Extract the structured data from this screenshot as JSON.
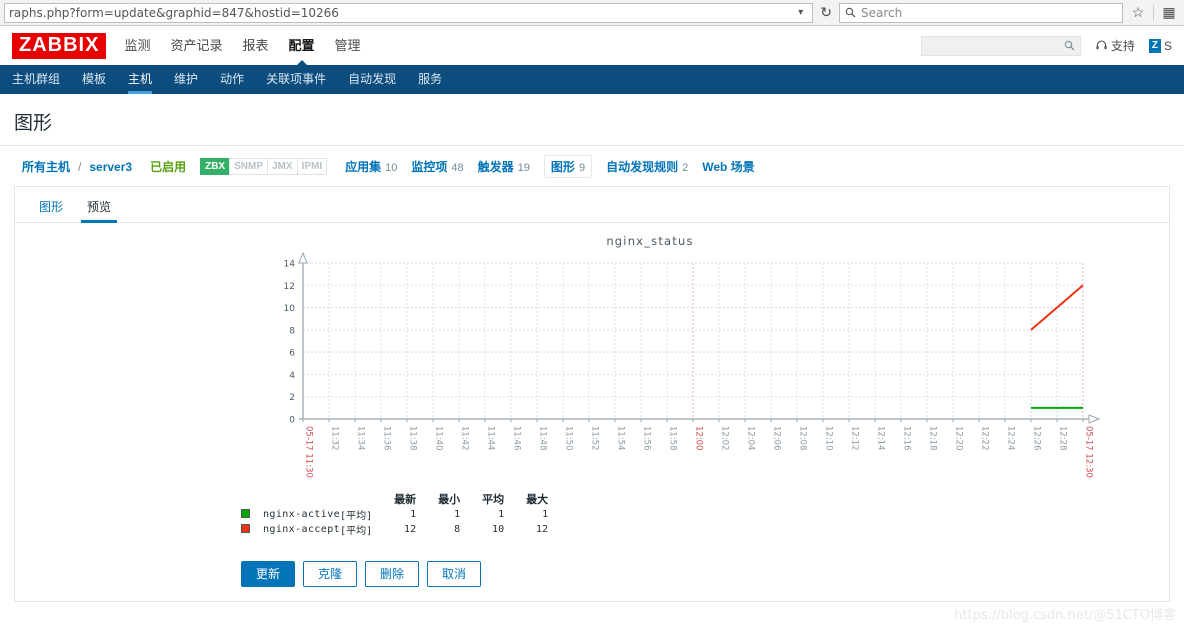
{
  "browser": {
    "url": "raphs.php?form=update&graphid=847&hostid=10266",
    "url_dropdown_icon": "chevron-down-icon",
    "reload_icon": "reload-icon",
    "search_placeholder": "Search",
    "search_icon": "search-icon",
    "bookmark_icon": "star-icon",
    "menu_icon": "library-icon"
  },
  "header": {
    "logo": "ZABBIX",
    "nav": [
      {
        "label": "监测",
        "selected": false
      },
      {
        "label": "资产记录",
        "selected": false
      },
      {
        "label": "报表",
        "selected": false
      },
      {
        "label": "配置",
        "selected": true
      },
      {
        "label": "管理",
        "selected": false
      }
    ],
    "search_value": "",
    "search_icon": "search-icon",
    "support_label": "支持",
    "support_icon": "headset-icon",
    "share_label": "S",
    "share_icon": "zabbix-share-icon"
  },
  "subnav": [
    {
      "label": "主机群组",
      "selected": false
    },
    {
      "label": "模板",
      "selected": false
    },
    {
      "label": "主机",
      "selected": true
    },
    {
      "label": "维护",
      "selected": false
    },
    {
      "label": "动作",
      "selected": false
    },
    {
      "label": "关联项事件",
      "selected": false
    },
    {
      "label": "自动发现",
      "selected": false
    },
    {
      "label": "服务",
      "selected": false
    }
  ],
  "page": {
    "title": "图形"
  },
  "breadcrumb": {
    "all_hosts": "所有主机",
    "separator": "/",
    "host": "server3",
    "status": "已启用",
    "interfaces": [
      {
        "label": "ZBX",
        "active": true
      },
      {
        "label": "SNMP",
        "active": false
      },
      {
        "label": "JMX",
        "active": false
      },
      {
        "label": "IPMI",
        "active": false
      }
    ],
    "items": [
      {
        "label": "应用集",
        "count": "10",
        "current": false
      },
      {
        "label": "监控项",
        "count": "48",
        "current": false
      },
      {
        "label": "触发器",
        "count": "19",
        "current": false
      },
      {
        "label": "图形",
        "count": "9",
        "current": true
      },
      {
        "label": "自动发现规则",
        "count": "2",
        "current": false
      },
      {
        "label": "Web 场景",
        "count": "",
        "current": false
      }
    ]
  },
  "tabs": [
    {
      "label": "图形",
      "active": false
    },
    {
      "label": "预览",
      "active": true
    }
  ],
  "chart_data": {
    "type": "line",
    "title": "nginx_status",
    "xlabel": "",
    "ylabel": "",
    "ylim": [
      0,
      14
    ],
    "yticks": [
      0,
      2,
      4,
      6,
      8,
      10,
      12,
      14
    ],
    "grid": true,
    "xticks": [
      "05-17 11:30",
      "11:32",
      "11:34",
      "11:36",
      "11:38",
      "11:40",
      "11:42",
      "11:44",
      "11:46",
      "11:48",
      "11:50",
      "11:52",
      "11:54",
      "11:56",
      "11:58",
      "12:00",
      "12:02",
      "12:04",
      "12:06",
      "12:08",
      "12:10",
      "12:12",
      "12:14",
      "12:16",
      "12:18",
      "12:20",
      "12:22",
      "12:24",
      "12:26",
      "12:28",
      "05-17 12:30"
    ],
    "highlighted_xticks": [
      "05-17 11:30",
      "12:00",
      "05-17 12:30"
    ],
    "series": [
      {
        "name": "nginx-active",
        "color": "#00aa00",
        "aggregate": "[平均]",
        "last": "1",
        "min": "1",
        "avg": "1",
        "max": "1",
        "points": [
          {
            "x": "12:26",
            "y": 1
          },
          {
            "x": "12:30",
            "y": 1
          }
        ]
      },
      {
        "name": "nginx-accept",
        "color": "#ee3311",
        "aggregate": "[平均]",
        "last": "12",
        "min": "8",
        "avg": "10",
        "max": "12",
        "points": [
          {
            "x": "12:26",
            "y": 8
          },
          {
            "x": "12:30",
            "y": 12
          }
        ]
      }
    ],
    "legend_headers": [
      "最新",
      "最小",
      "平均",
      "最大"
    ]
  },
  "buttons": [
    {
      "label": "更新",
      "primary": true
    },
    {
      "label": "克隆",
      "primary": false
    },
    {
      "label": "删除",
      "primary": false
    },
    {
      "label": "取消",
      "primary": false
    }
  ],
  "watermark": {
    "text_a": "https://blog.csdn.net/",
    "text_b": "@51CTO博客"
  }
}
